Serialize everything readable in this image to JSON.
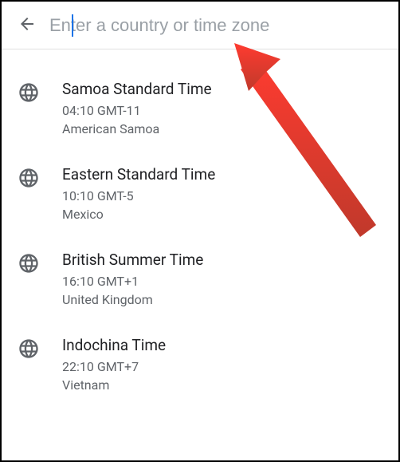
{
  "search": {
    "placeholder": "Enter a country or time zone",
    "value": ""
  },
  "timezones": [
    {
      "name": "Samoa Standard Time",
      "time": "04:10  GMT-11",
      "country": "American Samoa"
    },
    {
      "name": "Eastern Standard Time",
      "time": "10:10  GMT-5",
      "country": "Mexico"
    },
    {
      "name": "British Summer Time",
      "time": "16:10  GMT+1",
      "country": "United Kingdom"
    },
    {
      "name": "Indochina Time",
      "time": "22:10  GMT+7",
      "country": "Vietnam"
    }
  ]
}
